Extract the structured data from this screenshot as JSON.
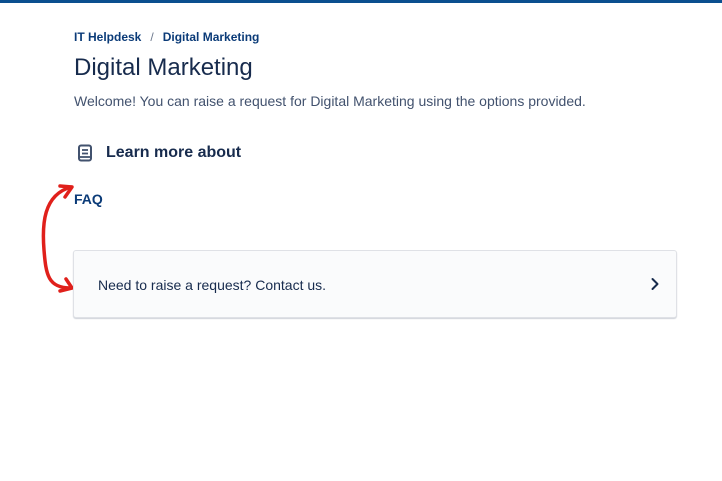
{
  "breadcrumb": {
    "root": "IT Helpdesk",
    "separator": "/",
    "current": "Digital Marketing"
  },
  "page": {
    "title": "Digital Marketing",
    "welcome": "Welcome! You can raise a request for Digital Marketing using the options provided."
  },
  "learn_more": {
    "icon": "book-icon",
    "label": "Learn more about"
  },
  "faq": {
    "label": "FAQ"
  },
  "request_card": {
    "text": "Need to raise a request? Contact us.",
    "icon": "chevron-right-icon"
  },
  "annotation": {
    "icon": "curved-double-arrow-icon",
    "color": "#e0201b"
  },
  "colors": {
    "top_bar": "#0b4f8f",
    "link": "#0b3b78",
    "text": "#172b4d"
  }
}
